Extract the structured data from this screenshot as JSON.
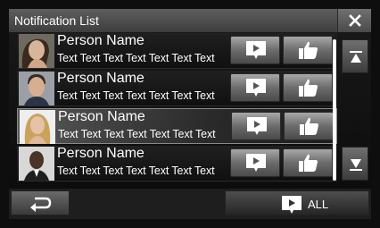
{
  "header": {
    "title": "Notification List",
    "close_icon": "close-icon"
  },
  "notifications": [
    {
      "name": "Person Name",
      "text": "Text Text Text Text Text Text Text",
      "avatar": "woman-avatar",
      "selected": false
    },
    {
      "name": "Person Name",
      "text": "Text Text Text Text Text Text Text",
      "avatar": "man-avatar",
      "selected": false
    },
    {
      "name": "Person Name",
      "text": "Text Text Text Text Text Text Text",
      "avatar": "blonde-woman-avatar",
      "selected": true
    },
    {
      "name": "Person Name",
      "text": "Text Text Text Text Text Text Text",
      "avatar": "dark-man-avatar",
      "selected": false
    }
  ],
  "row_actions": {
    "play_icon": "play-icon",
    "like_icon": "thumbs-up-icon"
  },
  "scroll": {
    "up_icon": "scroll-up-icon",
    "down_icon": "scroll-down-icon"
  },
  "footer": {
    "back_icon": "back-arrow-icon",
    "play_all_icon": "play-icon",
    "play_all_label": "ALL"
  }
}
